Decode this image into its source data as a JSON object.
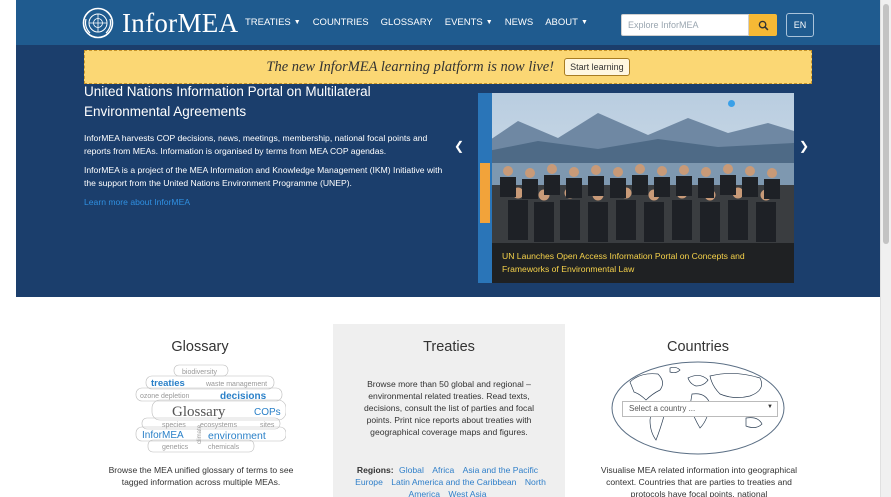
{
  "header": {
    "logo_text": "InforMEA",
    "nav": [
      {
        "label": "TREATIES",
        "dropdown": true
      },
      {
        "label": "COUNTRIES",
        "dropdown": false
      },
      {
        "label": "GLOSSARY",
        "dropdown": false
      },
      {
        "label": "EVENTS",
        "dropdown": true
      },
      {
        "label": "NEWS",
        "dropdown": false
      },
      {
        "label": "ABOUT",
        "dropdown": true
      }
    ],
    "search_placeholder": "Explore InforMEA",
    "language": "EN",
    "colors": {
      "bar": "#1f5b8f",
      "search_button": "#f6b935"
    }
  },
  "banner": {
    "text": "The new InforMEA learning platform is now live!",
    "button": "Start learning"
  },
  "hero": {
    "title": "United Nations Information Portal on Multilateral Environmental Agreements",
    "paragraph1": "InforMEA harvests COP decisions, news, meetings, membership, national focal points and reports from MEAs. Information is organised by terms from MEA COP agendas.",
    "paragraph2": "InforMEA is a project of the MEA Information and Knowledge Management (IKM) Initiative with the support from the United Nations Environment Programme (UNEP).",
    "link": "Learn more about InforMEA",
    "slide_caption": "UN Launches Open Access Information Portal on Concepts and Frameworks of Environmental Law"
  },
  "glossary": {
    "title": "Glossary",
    "cloud_words": [
      "biodiversity",
      "treaties",
      "waste management",
      "ozone depletion",
      "decisions",
      "Glossary",
      "COPs",
      "species",
      "ecosystems",
      "sites",
      "InforMEA",
      "climate",
      "environment",
      "genetics",
      "chemicals"
    ],
    "description": "Browse the MEA unified glossary of terms to see tagged information across multiple MEAs."
  },
  "treaties": {
    "title": "Treaties",
    "description": "Browse more than 50 global and regional – environmental related treaties. Read texts, decisions, consult the list of parties and focal points. Print nice reports about treaties with geographical coverage maps and figures.",
    "regions_label": "Regions:",
    "regions": [
      "Global",
      "Africa",
      "Asia and the Pacific",
      "Europe",
      "Latin America and the Caribbean",
      "North America",
      "West Asia"
    ]
  },
  "countries": {
    "title": "Countries",
    "select_placeholder": "Select a country ...",
    "description": "Visualise MEA related information into geographical context. Countries that are parties to treaties and protocols have focal points, national"
  }
}
